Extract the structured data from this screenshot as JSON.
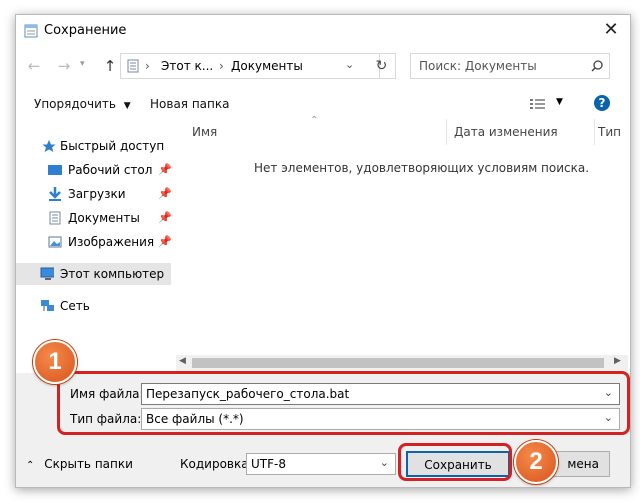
{
  "window": {
    "title": "Сохранение"
  },
  "nav": {
    "back": "←",
    "forward": "→",
    "up": "↑",
    "breadcrumb": [
      "Этот к...",
      "Документы"
    ],
    "search_placeholder": "Поиск: Документы"
  },
  "toolbar": {
    "organize": "Упорядочить",
    "new_folder": "Новая папка",
    "help": "?"
  },
  "sidebar": {
    "quick_access": "Быстрый доступ",
    "items": [
      {
        "label": "Рабочий стол",
        "icon": "desktop-icon"
      },
      {
        "label": "Загрузки",
        "icon": "download-icon"
      },
      {
        "label": "Документы",
        "icon": "documents-icon"
      },
      {
        "label": "Изображения",
        "icon": "pictures-icon"
      }
    ],
    "this_pc": "Этот компьютер",
    "network": "Сеть"
  },
  "content": {
    "columns": [
      "Имя",
      "Дата изменения",
      "Тип"
    ],
    "empty_message": "Нет элементов, удовлетворяющих условиям поиска."
  },
  "form": {
    "filename_label": "Имя файла:",
    "filename_value": "Перезапуск_рабочего_стола.bat",
    "filetype_label": "Тип файла:",
    "filetype_value": "Все файлы  (*.*)"
  },
  "footer": {
    "hide_folders": "Скрыть папки",
    "encoding_label": "Кодировка:",
    "encoding_value": "UTF-8",
    "save": "Сохранить",
    "cancel_partial": "мена"
  },
  "annotations": {
    "badge1": "1",
    "badge2": "2"
  },
  "colors": {
    "highlight": "#d42121",
    "badge": "#e0631f",
    "selected": "#e5e5e5",
    "accent": "#0a64ad"
  }
}
